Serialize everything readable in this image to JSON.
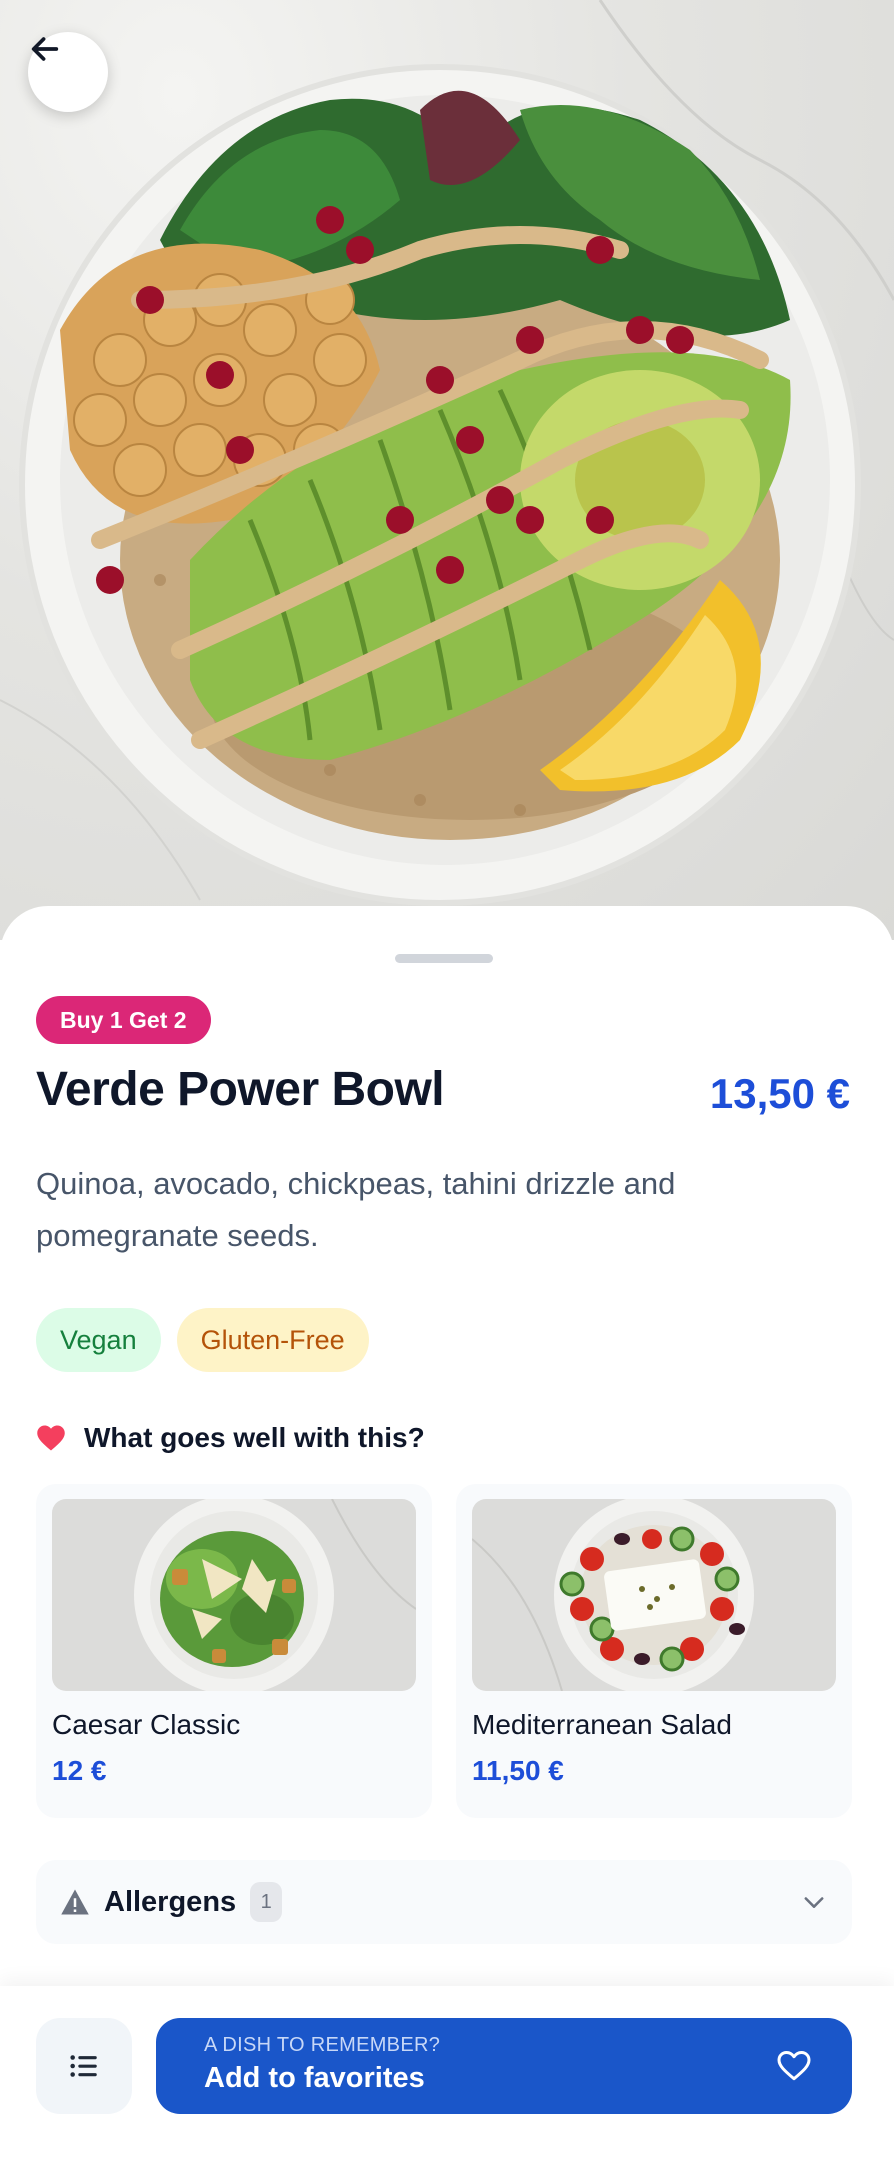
{
  "hero": {
    "image_alt": "Bowl with spinach, chickpeas, avocado, quinoa, pomegranate seeds, lemon and tahini drizzle"
  },
  "nav": {
    "back_icon": "arrow-left-icon"
  },
  "dish": {
    "promo_badge": "Buy 1 Get 2",
    "name": "Verde Power Bowl",
    "price": "13,50 €",
    "description": "Quinoa, avocado, chickpeas, tahini drizzle and pomegranate seeds.",
    "tags": [
      "Vegan",
      "Gluten-Free"
    ]
  },
  "pairings": {
    "heading": "What goes well with this?",
    "icon": "heart-icon",
    "items": [
      {
        "name": "Caesar Classic",
        "price": "12 €"
      },
      {
        "name": "Mediterranean Salad",
        "price": "11,50 €"
      }
    ]
  },
  "allergens": {
    "label": "Allergens",
    "count": "1",
    "icon": "warning-icon"
  },
  "bottom_bar": {
    "menu_icon": "list-icon",
    "favorite_caption": "A DISH TO REMEMBER?",
    "favorite_label": "Add to favorites",
    "favorite_icon": "heart-outline-icon"
  },
  "colors": {
    "accent": "#1a56c9",
    "promo": "#db2777",
    "price": "#1d4ed8",
    "vegan_bg": "#dcfce7",
    "gluten_free_bg": "#fef3c7"
  }
}
